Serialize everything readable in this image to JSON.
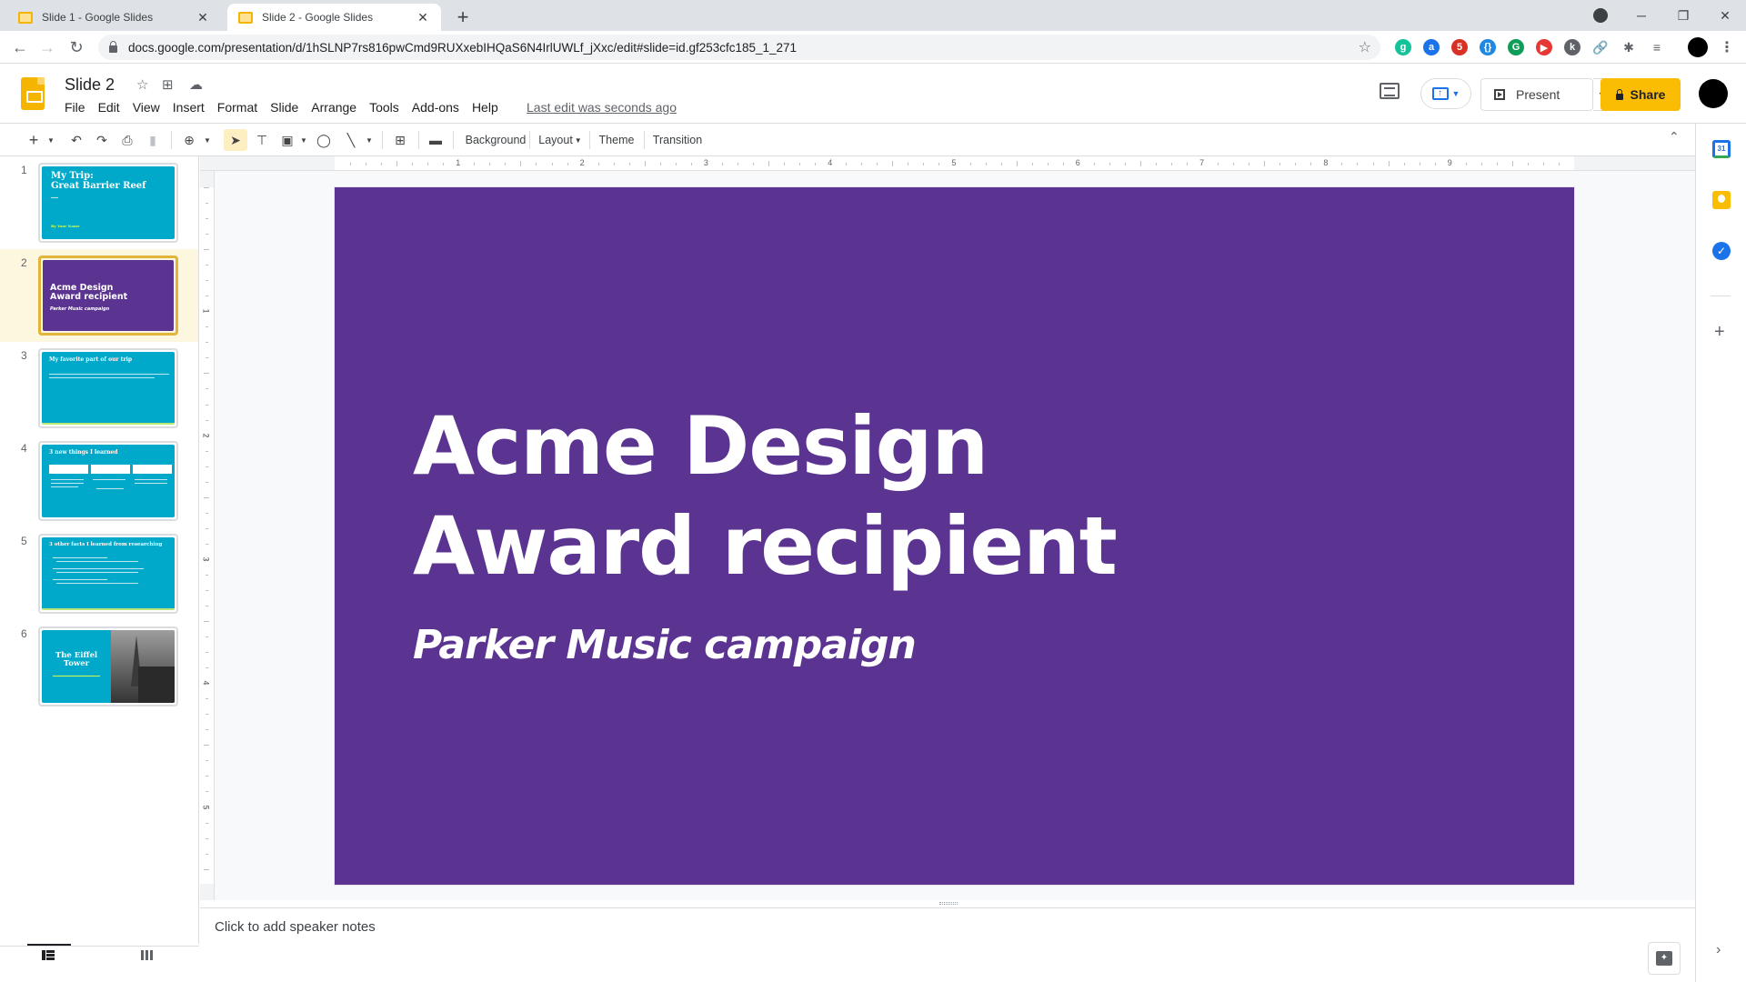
{
  "browser": {
    "tabs": [
      {
        "title": "Slide 1 - Google Slides",
        "active": false
      },
      {
        "title": "Slide 2 - Google Slides",
        "active": true
      }
    ],
    "new_tab_icon": "+",
    "url": "docs.google.com/presentation/d/1hSLNP7rs816pwCmd9RUXxebIHQaS6N4IrlUWLf_jXxc/edit#slide=id.gf253cfc185_1_271",
    "extensions": [
      {
        "name": "grammarly",
        "glyph": "g",
        "color": "#15c39a"
      },
      {
        "name": "a-extension",
        "glyph": "a",
        "color": "#1a73e8"
      },
      {
        "name": "meeting-extension",
        "glyph": "5",
        "color": "#d93025"
      },
      {
        "name": "css-extension",
        "glyph": "{}",
        "color": "#1e88e5"
      },
      {
        "name": "g-extension",
        "glyph": "G",
        "color": "#0f9d58"
      },
      {
        "name": "video-extension",
        "glyph": "▶",
        "color": "#e53935"
      },
      {
        "name": "cursor-extension",
        "glyph": "k",
        "color": "#5f6368"
      },
      {
        "name": "link-extension",
        "glyph": "🔗",
        "color": "#5f6368"
      },
      {
        "name": "puzzle-extension",
        "glyph": "✱",
        "color": "#5f6368"
      },
      {
        "name": "media-extension",
        "glyph": "≡",
        "color": "#5f6368"
      }
    ]
  },
  "header": {
    "doc_title": "Slide 2",
    "menu": [
      "File",
      "Edit",
      "View",
      "Insert",
      "Format",
      "Slide",
      "Arrange",
      "Tools",
      "Add-ons",
      "Help"
    ],
    "last_edit": "Last edit was seconds ago",
    "present_label": "Present",
    "share_label": "Share",
    "share_color": "#fbbc04"
  },
  "toolbar": {
    "background_label": "Background",
    "layout_label": "Layout",
    "theme_label": "Theme",
    "transition_label": "Transition"
  },
  "filmstrip": {
    "slides": [
      {
        "num": "1",
        "title": "My Trip:\nGreat Barrier Reef",
        "subtitle": "By Your Name",
        "bg": "#00a8c9"
      },
      {
        "num": "2",
        "title": "Acme Design\nAward recipient",
        "subtitle": "Parker Music campaign",
        "bg": "#5b3492",
        "active": true
      },
      {
        "num": "3",
        "title": "My favorite part of our trip",
        "bg": "#00a8c9"
      },
      {
        "num": "4",
        "title": "3 new things I learned",
        "bg": "#00a8c9"
      },
      {
        "num": "5",
        "title": "3 other facts I learned from researching",
        "bg": "#00a8c9"
      },
      {
        "num": "6",
        "title": "The Eiffel\nTower",
        "bg": "#00a8c9"
      }
    ]
  },
  "ruler": {
    "h_numbers": [
      "1",
      "2",
      "3",
      "4",
      "5",
      "6",
      "7",
      "8",
      "9"
    ],
    "v_numbers": [
      "1",
      "2",
      "3",
      "4",
      "5"
    ]
  },
  "slide": {
    "title_line1": "Acme Design",
    "title_line2": "Award recipient",
    "subtitle": "Parker Music campaign",
    "background": "#5b3492"
  },
  "notes": {
    "placeholder": "Click to add speaker notes"
  }
}
